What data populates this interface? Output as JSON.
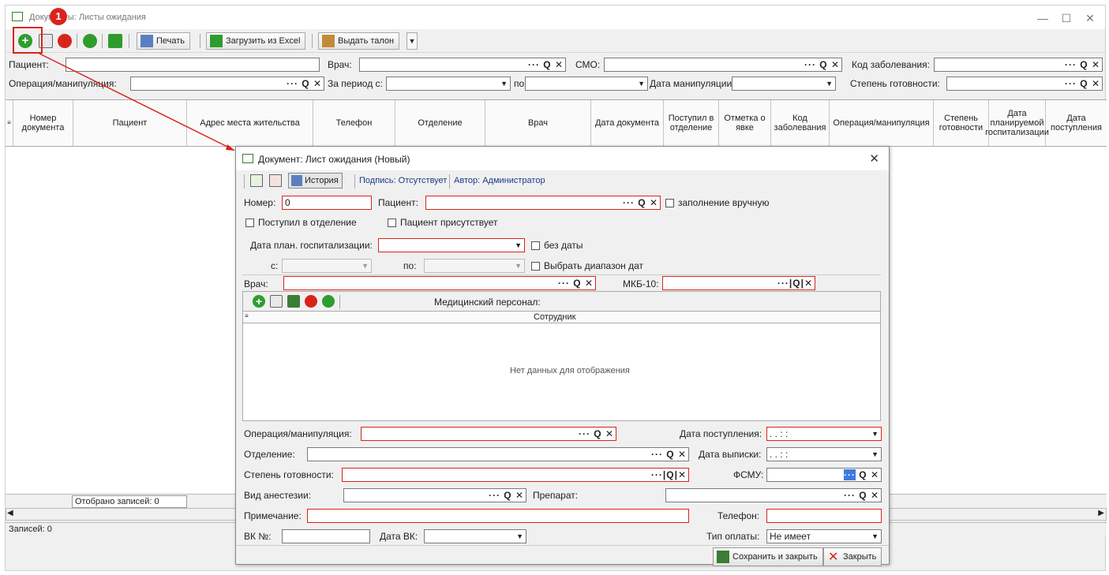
{
  "window": {
    "title": "Документы: Листы ожидания"
  },
  "toolbar": {
    "print": "Печать",
    "excel": "Загрузить из Excel",
    "ticket": "Выдать талон"
  },
  "filters": {
    "patient": "Пациент:",
    "doctor": "Врач:",
    "smo": "СМО:",
    "disease_code": "Код заболевания:",
    "operation": "Операция/манипуляция:",
    "period_from": "За период с:",
    "period_to": "по",
    "manip_date": "Дата манипуляции:",
    "readiness": "Степень готовности:"
  },
  "grid": {
    "columns": [
      "Номер документа",
      "Пациент",
      "Адрес места жительства",
      "Телефон",
      "Отделение",
      "Врач",
      "Дата документа",
      "Поступил в отделение",
      "Отметка о явке",
      "Код заболевания",
      "Операция/манипуляция",
      "Степень готовности",
      "Дата планируемой госпитализации",
      "Дата поступления"
    ],
    "selected_count": "Отобрано записей: 0",
    "status": "Записей: 0"
  },
  "callout": "1",
  "modal": {
    "title": "Документ: Лист ожидания (Новый)",
    "history": "История",
    "signature": "Подпись: Отсутствует",
    "author": "Автор: Администратор",
    "number_label": "Номер:",
    "number_value": "0",
    "patient_label": "Пациент:",
    "manual_fill": "заполнение вручную",
    "admitted": "Поступил в отделение",
    "present": "Пациент присутствует",
    "plan_date_label": "Дата план. госпитализации:",
    "no_date": "без даты",
    "from_label": "с:",
    "to_label": "по:",
    "date_range": "Выбрать диапазон дат",
    "doctor_label": "Врач:",
    "mkb_label": "МКБ-10:",
    "med_staff": "Медицинский персонал:",
    "employee_col": "Сотрудник",
    "no_data": "Нет данных для отображения",
    "operation_label": "Операция/манипуляция:",
    "admit_date_label": "Дата поступления:",
    "admit_date_value": ". .    : :",
    "department_label": "Отделение:",
    "discharge_label": "Дата выписки:",
    "discharge_value": ". .    : :",
    "readiness_label": "Степень готовности:",
    "fsmu_label": "ФСМУ:",
    "anesthesia_label": "Вид анестезии:",
    "drug_label": "Препарат:",
    "note_label": "Примечание:",
    "phone_label": "Телефон:",
    "vk_label": "ВК №:",
    "vk_date_label": "Дата ВК:",
    "payment_label": "Тип оплаты:",
    "payment_value": "Не имеет",
    "save_close": "Сохранить и закрыть",
    "close": "Закрыть"
  }
}
